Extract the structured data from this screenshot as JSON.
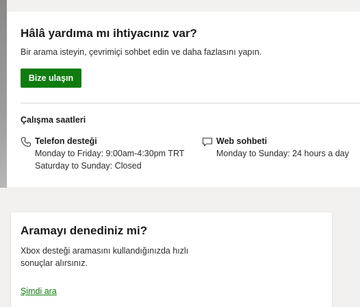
{
  "help_card": {
    "title": "Hâlâ yardıma mı ihtiyacınız var?",
    "subtitle": "Bir arama isteyin, çevrimiçi sohbet edin ve daha fazlasını yapın.",
    "contact_button": "Bize ulaşın",
    "hours_heading": "Çalışma saatleri",
    "channels": [
      {
        "name": "Telefon desteği",
        "icon": "phone-icon",
        "lines": [
          "Monday to Friday: 9:00am-4:30pm TRT",
          "Saturday to Sunday: Closed"
        ]
      },
      {
        "name": "Web sohbeti",
        "icon": "chat-bubble-icon",
        "lines": [
          "Monday to Sunday: 24 hours a day"
        ]
      }
    ]
  },
  "search_card": {
    "title": "Aramayı denediniz mi?",
    "description": "Xbox desteği aramasını kullandığınızda hızlı sonuçlar alırsınız.",
    "link": "Şimdi ara"
  },
  "colors": {
    "accent": "#107c10",
    "page_background": "#f2f1ef",
    "card_background": "#ffffff"
  }
}
